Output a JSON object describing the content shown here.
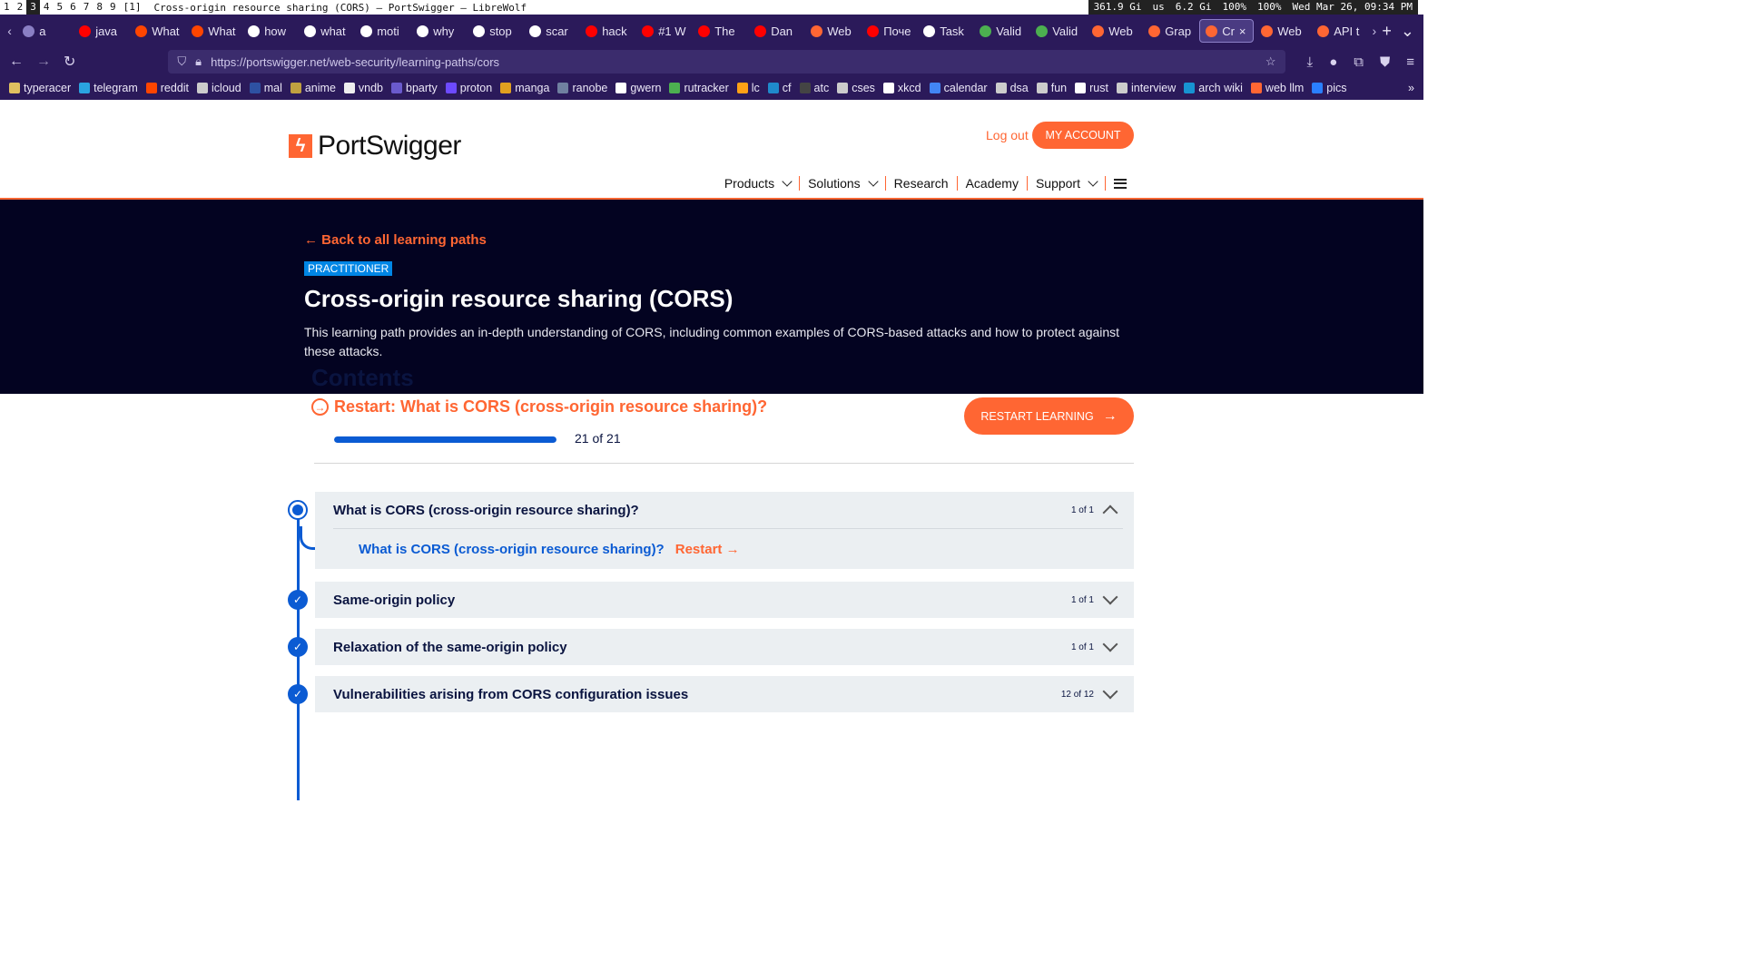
{
  "sysbar": {
    "workspaces": [
      "1",
      "2",
      "3",
      "4",
      "5",
      "6",
      "7",
      "8",
      "9"
    ],
    "layout": "[1]",
    "window_title": "Cross-origin resource sharing (CORS) – PortSwigger — LibreWolf",
    "disk": "361.9 Gi",
    "keyboard": "us",
    "memory": "6.2 Gi",
    "battery": "100%",
    "volume": "100%",
    "datetime": "Wed Mar 26, 09:34 PM"
  },
  "tabs": [
    {
      "label": "a",
      "color": "#8a7fc4"
    },
    {
      "label": "java",
      "color": "#ff0000"
    },
    {
      "label": "What",
      "color": "#ff4500"
    },
    {
      "label": "What",
      "color": "#ff4500"
    },
    {
      "label": "how",
      "color": "#ffffff"
    },
    {
      "label": "what",
      "color": "#ffffff"
    },
    {
      "label": "moti",
      "color": "#ffffff"
    },
    {
      "label": "why",
      "color": "#ffffff"
    },
    {
      "label": "stop",
      "color": "#ffffff"
    },
    {
      "label": "scar",
      "color": "#ffffff"
    },
    {
      "label": "hack",
      "color": "#ff0000"
    },
    {
      "label": "#1 W",
      "color": "#ff0000"
    },
    {
      "label": "The",
      "color": "#ff0000"
    },
    {
      "label": "Dan",
      "color": "#ff0000"
    },
    {
      "label": "Web",
      "color": "#ff6633"
    },
    {
      "label": "Поче",
      "color": "#ff0000"
    },
    {
      "label": "Task",
      "color": "#ffffff"
    },
    {
      "label": "Valid",
      "color": "#4caf50"
    },
    {
      "label": "Valid",
      "color": "#4caf50"
    },
    {
      "label": "Web",
      "color": "#ff6633"
    },
    {
      "label": "Grap",
      "color": "#ff6633"
    },
    {
      "label": "Cr",
      "color": "#ff6633",
      "active": true
    },
    {
      "label": "Web",
      "color": "#ff6633"
    },
    {
      "label": "API t",
      "color": "#ff6633"
    }
  ],
  "url": "https://portswigger.net/web-security/learning-paths/cors",
  "bookmarks": [
    {
      "label": "typeracer",
      "color": "#e0c060"
    },
    {
      "label": "telegram",
      "color": "#2aa3e0"
    },
    {
      "label": "reddit",
      "color": "#ff4500"
    },
    {
      "label": "icloud",
      "color": "#cccccc"
    },
    {
      "label": "mal",
      "color": "#2e51a2"
    },
    {
      "label": "anime",
      "color": "#c0a040"
    },
    {
      "label": "vndb",
      "color": "#eeeeee"
    },
    {
      "label": "bparty",
      "color": "#6a5acd"
    },
    {
      "label": "proton",
      "color": "#6d4aff"
    },
    {
      "label": "manga",
      "color": "#e0a020"
    },
    {
      "label": "ranobe",
      "color": "#7080a0"
    },
    {
      "label": "gwern",
      "color": "#ffffff"
    },
    {
      "label": "rutracker",
      "color": "#4caf50"
    },
    {
      "label": "lc",
      "color": "#ffa116"
    },
    {
      "label": "cf",
      "color": "#1f8acb"
    },
    {
      "label": "atc",
      "color": "#444444"
    },
    {
      "label": "cses",
      "color": "#cccccc"
    },
    {
      "label": "xkcd",
      "color": "#ffffff"
    },
    {
      "label": "calendar",
      "color": "#4285f4"
    },
    {
      "label": "dsa",
      "color": "#cccccc"
    },
    {
      "label": "fun",
      "color": "#cccccc"
    },
    {
      "label": "rust",
      "color": "#ffffff"
    },
    {
      "label": "interview",
      "color": "#cccccc"
    },
    {
      "label": "arch wiki",
      "color": "#1793d1"
    },
    {
      "label": "web llm",
      "color": "#ff6633"
    },
    {
      "label": "pics",
      "color": "#2a7fff"
    }
  ],
  "site": {
    "logo_text": "PortSwigger",
    "logout": "Log out",
    "my_account": "MY ACCOUNT",
    "nav": [
      "Products",
      "Solutions",
      "Research",
      "Academy",
      "Support"
    ]
  },
  "hero": {
    "back": "Back to all learning paths",
    "badge": "PRACTITIONER",
    "title": "Cross-origin resource sharing (CORS)",
    "description": "This learning path provides an in-depth understanding of CORS, including common examples of CORS-based attacks and how to protect against these attacks."
  },
  "contents": {
    "heading": "Contents",
    "restart_link": "Restart: What is CORS (cross-origin resource sharing)?",
    "progress_text": "21 of 21",
    "progress_fraction": 1.0,
    "restart_button": "RESTART LEARNING"
  },
  "sections": [
    {
      "title": "What is CORS (cross-origin resource sharing)?",
      "count": "1 of 1",
      "expanded": true,
      "sub": {
        "title": "What is CORS (cross-origin resource sharing)?",
        "action": "Restart"
      }
    },
    {
      "title": "Same-origin policy",
      "count": "1 of 1"
    },
    {
      "title": "Relaxation of the same-origin policy",
      "count": "1 of 1"
    },
    {
      "title": "Vulnerabilities arising from CORS configuration issues",
      "count": "12 of 12"
    }
  ],
  "colors": {
    "accent": "#ff6633",
    "primary": "#0b5bd3",
    "hero_bg": "#030321"
  }
}
